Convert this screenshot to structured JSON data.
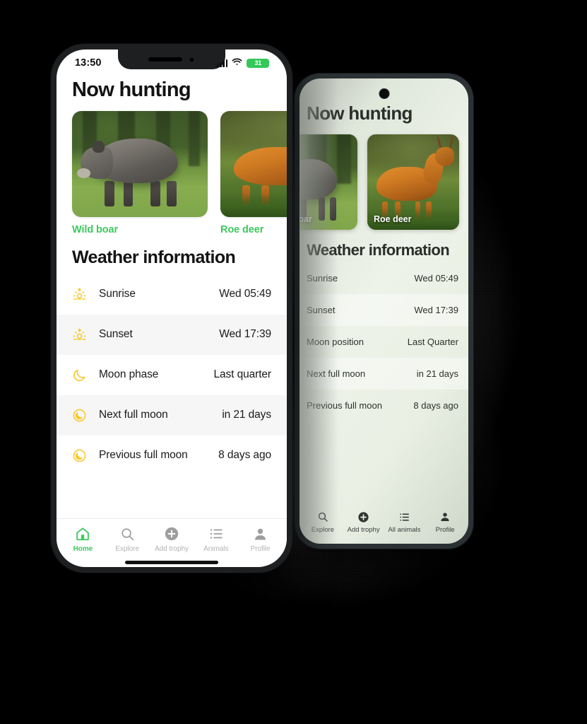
{
  "background": {
    "color": "#000000",
    "glow_color": "#b9b9b9"
  },
  "front_phone": {
    "status_bar": {
      "time": "13:50",
      "signal_icon": "cellular-bars-icon",
      "wifi_icon": "wifi-icon",
      "battery_level": "31",
      "battery_color": "#34C759"
    },
    "title": "Now hunting",
    "animals": [
      {
        "label": "Wild boar",
        "image": "wild-boar-photo"
      },
      {
        "label": "Roe deer",
        "image": "roe-deer-photo"
      }
    ],
    "animal_label_color": "#3CC95E",
    "weather_title": "Weather information",
    "weather_rows": [
      {
        "icon": "sunrise-icon",
        "name": "Sunrise",
        "value": "Wed 05:49"
      },
      {
        "icon": "sunset-icon",
        "name": "Sunset",
        "value": "Wed 17:39"
      },
      {
        "icon": "moon-crescent-icon",
        "name": "Moon phase",
        "value": "Last quarter"
      },
      {
        "icon": "full-moon-icon",
        "name": "Next full moon",
        "value": "in 21 days"
      },
      {
        "icon": "full-moon-icon",
        "name": "Previous full moon",
        "value": "8 days ago"
      }
    ],
    "tabs": [
      {
        "label": "Home",
        "icon": "home-icon",
        "active": true
      },
      {
        "label": "Explore",
        "icon": "search-icon",
        "active": false
      },
      {
        "label": "Add trophy",
        "icon": "plus-circle-icon",
        "active": false
      },
      {
        "label": "Animals",
        "icon": "list-icon",
        "active": false
      },
      {
        "label": "Profile",
        "icon": "person-icon",
        "active": false
      }
    ],
    "active_tab_color": "#3CC95E"
  },
  "back_phone": {
    "camera": "punch-hole-camera",
    "title": "Now hunting",
    "animals": [
      {
        "label": "Wild boar",
        "image": "wild-boar-photo"
      },
      {
        "label": "Roe deer",
        "image": "roe-deer-photo"
      }
    ],
    "weather_title": "Weather information",
    "weather_rows": [
      {
        "name": "Sunrise",
        "value": "Wed 05:49"
      },
      {
        "name": "Sunset",
        "value": "Wed 17:39"
      },
      {
        "name": "Moon position",
        "value": "Last Quarter"
      },
      {
        "name": "Next full moon",
        "value": "in 21 days"
      },
      {
        "name": "Previous full moon",
        "value": "8 days ago"
      }
    ],
    "tabs": [
      {
        "label": "Explore",
        "icon": "search-icon"
      },
      {
        "label": "Add trophy",
        "icon": "plus-circle-icon"
      },
      {
        "label": "All animals",
        "icon": "list-icon"
      },
      {
        "label": "Profile",
        "icon": "person-icon"
      }
    ]
  }
}
